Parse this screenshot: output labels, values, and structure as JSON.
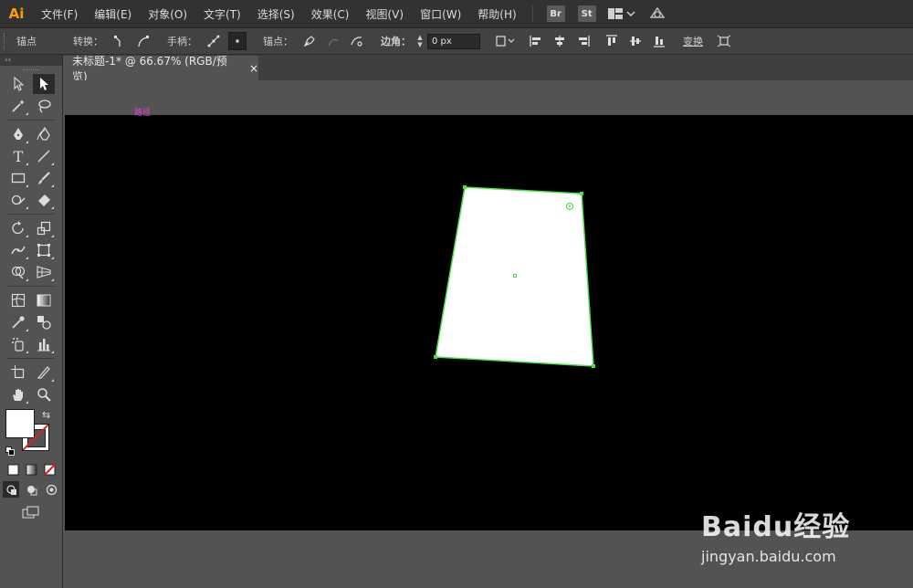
{
  "app": {
    "logo": "Ai"
  },
  "menu": [
    "文件(F)",
    "编辑(E)",
    "对象(O)",
    "文字(T)",
    "选择(S)",
    "效果(C)",
    "视图(V)",
    "窗口(W)",
    "帮助(H)"
  ],
  "app_buttons": {
    "bridge": "Br",
    "stock": "St"
  },
  "control_bar": {
    "anchor_title": "锚点",
    "convert_label": "转换：",
    "handles_label": "手柄：",
    "anchors_label": "锚点：",
    "corner_label": "边角：",
    "corner_value": "0 px",
    "transform_label": "变换"
  },
  "toolbox": {
    "collapse": "‹‹"
  },
  "document": {
    "tab_title": "未标题-1* @ 66.67% (RGB/预览)",
    "close": "×"
  },
  "canvas": {
    "artboard_color": "#000000",
    "shape_fill": "#ffffff",
    "path_color": "#4be04b",
    "path_label": "路径",
    "path_label_color": "#d447d4"
  },
  "watermark": {
    "logo": "Baidu经验",
    "url": "jingyan.baidu.com"
  }
}
